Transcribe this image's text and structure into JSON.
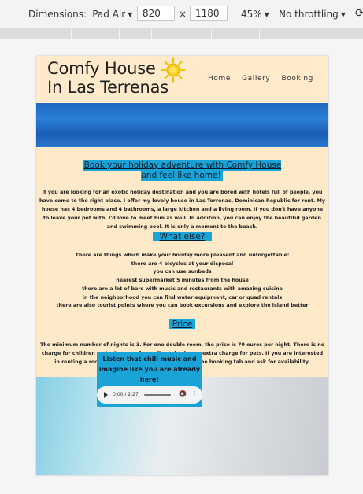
{
  "devtools": {
    "dimensions_label": "Dimensions: iPad Air",
    "width": "820",
    "times": "×",
    "height": "1180",
    "zoom": "45%",
    "throttling": "No throttling"
  },
  "site": {
    "brand_line1": "Comfy House",
    "brand_line2": "In Las Terrenas",
    "nav": [
      "Home",
      "Gallery",
      "Booking"
    ],
    "main_heading": "Book your holiday adventure with Comfy House and feel like home!",
    "intro": "If you are looking for an exotic holiday destination and you are bored with hotels full of people, you have come to the right place. I offer my lovely house in Las Terrenas, Dominican Republic for rent. My house has 4 bedrooms and 4 bathrooms, a large kitchen and a living room. If you don't have anyone to leave your pet with, I'd love to meet him as well. In addition, you can enjoy the beautiful garden and swimming pool. It is only a moment to the beach.",
    "what_else_heading": "What else?",
    "what_else_items": [
      "There are things which make your holiday more pleasent and unforgettable:",
      "there are 4 bicycles at your disposal",
      "you can use sunbeds",
      "nearest supermarket 5 minutes from the house",
      "there are a lot of bars with music and restaurants with amazing cuisine",
      "in the neighborhood you can find water equipment, car or quad rentals",
      "there are also tourist points where you can book excursions and explore the island better"
    ],
    "price_heading": "Price",
    "price_text": "The minimum number of nights is 3. For one double room, the price is 70 euros per night. There is no charge for children up to 6 years of age. There is also no extra charge for pets. If you are interested in renting a room or the whole house, please go to the booking tab and ask for availability.",
    "music_text": "Listen that chill music and imagine like you are already here!",
    "audio_time": "0:00 / 2:27"
  },
  "colors": {
    "page_bg": "#fde9c9",
    "highlight": "#1aa3d6",
    "hero_blue": "#2b7fd8"
  }
}
